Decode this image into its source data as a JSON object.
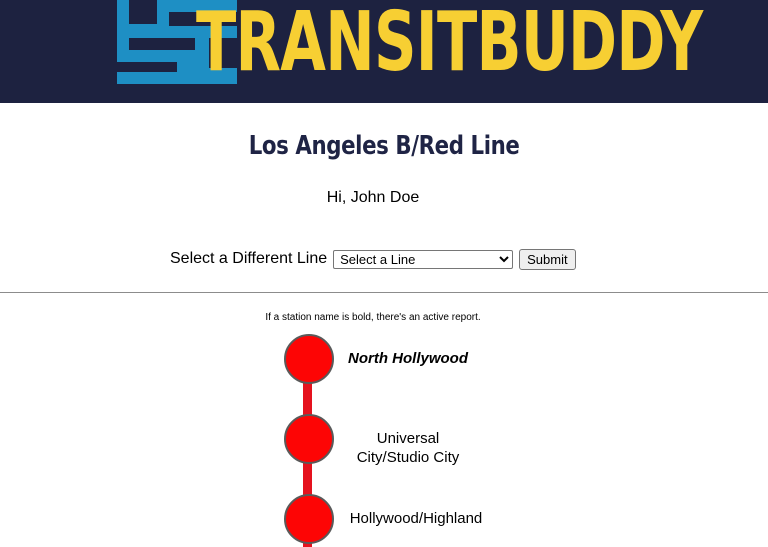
{
  "header": {
    "brand": "TRANSITBUDDY",
    "brand_color": "#f7cf33",
    "background_color": "#1d2240"
  },
  "page": {
    "title": "Los Angeles B/Red Line",
    "greeting": "Hi, John Doe"
  },
  "line_selector": {
    "label": "Select a Different Line",
    "select_value": "Select a Line",
    "submit_label": "Submit"
  },
  "legend_note": "If a station name is bold, there's an active report.",
  "line_color": "#e5121e",
  "stations": [
    {
      "name": "North Hollywood",
      "has_report": true
    },
    {
      "name_line1": "Universal",
      "name_line2": "City/Studio City",
      "has_report": false
    },
    {
      "name": "Hollywood/Highland",
      "has_report": false
    }
  ]
}
